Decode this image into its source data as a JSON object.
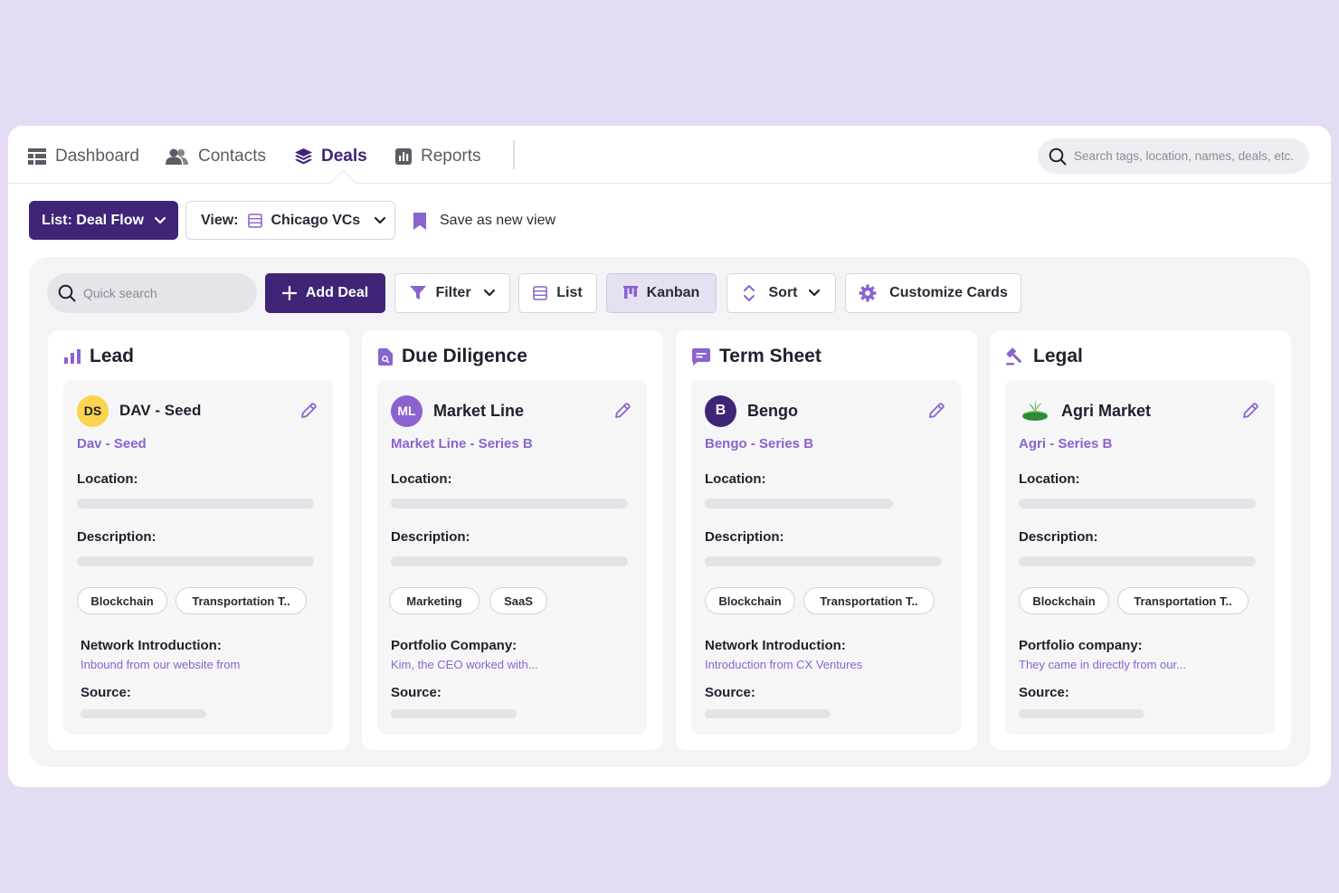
{
  "nav": {
    "items": [
      {
        "label": "Dashboard",
        "icon": "dashboard-icon"
      },
      {
        "label": "Contacts",
        "icon": "users-icon"
      },
      {
        "label": "Deals",
        "icon": "layers-icon",
        "active": true
      },
      {
        "label": "Reports",
        "icon": "bar-chart-icon"
      }
    ],
    "search_placeholder": "Search tags, location, names, deals, etc."
  },
  "toolbar": {
    "list_label": "List: Deal Flow",
    "view_label": "View:",
    "view_value": "Chicago VCs",
    "save_view_label": "Save as new view"
  },
  "board_toolbar": {
    "quick_search_placeholder": "Quick search",
    "add_deal": "Add Deal",
    "filter": "Filter",
    "list": "List",
    "kanban": "Kanban",
    "sort": "Sort",
    "customize": "Customize Cards"
  },
  "colors": {
    "primary": "#3f2477",
    "accent": "#8a63cf",
    "background": "#e5dcf3"
  },
  "columns": [
    {
      "title": "Lead",
      "icon": "bar-chart-icon",
      "card": {
        "avatar": "DS",
        "avatar_bg": "#fcd34d",
        "avatar_fg": "#1f1f2e",
        "title": "DAV - Seed",
        "subtitle": "Dav - Seed",
        "location_label": "Location:",
        "description_label": "Description:",
        "tags": [
          "Blockchain",
          "Transportation T.."
        ],
        "intro_label": "Network Introduction:",
        "intro_text": "Inbound from our website from",
        "source_label": "Source:"
      }
    },
    {
      "title": "Due Diligence",
      "icon": "document-search-icon",
      "card": {
        "avatar": "ML",
        "avatar_bg": "#8a63cf",
        "avatar_fg": "#ffffff",
        "title": "Market Line",
        "subtitle": "Market Line - Series B",
        "location_label": "Location:",
        "description_label": "Description:",
        "tags": [
          "Marketing",
          "SaaS"
        ],
        "intro_label": "Portfolio Company:",
        "intro_text": "Kim, the CEO worked with...",
        "source_label": "Source:"
      }
    },
    {
      "title": "Term Sheet",
      "icon": "message-icon",
      "card": {
        "avatar": "B",
        "avatar_bg": "#3f2477",
        "avatar_fg": "#ffffff",
        "title": "Bengo",
        "subtitle": "Bengo - Series B",
        "location_label": "Location:",
        "description_label": "Description:",
        "tags": [
          "Blockchain",
          "Transportation T.."
        ],
        "intro_label": "Network Introduction:",
        "intro_text": "Introduction from CX Ventures",
        "source_label": "Source:"
      }
    },
    {
      "title": "Legal",
      "icon": "gavel-icon",
      "card": {
        "avatar": "",
        "avatar_bg": "transparent",
        "avatar_fg": "#1f1f2e",
        "title": "Agri Market",
        "subtitle": "Agri - Series B",
        "location_label": "Location:",
        "description_label": "Description:",
        "tags": [
          "Blockchain",
          "Transportation T.."
        ],
        "intro_label": "Portfolio company:",
        "intro_text": "They came in directly from our...",
        "source_label": "Source:"
      }
    }
  ]
}
